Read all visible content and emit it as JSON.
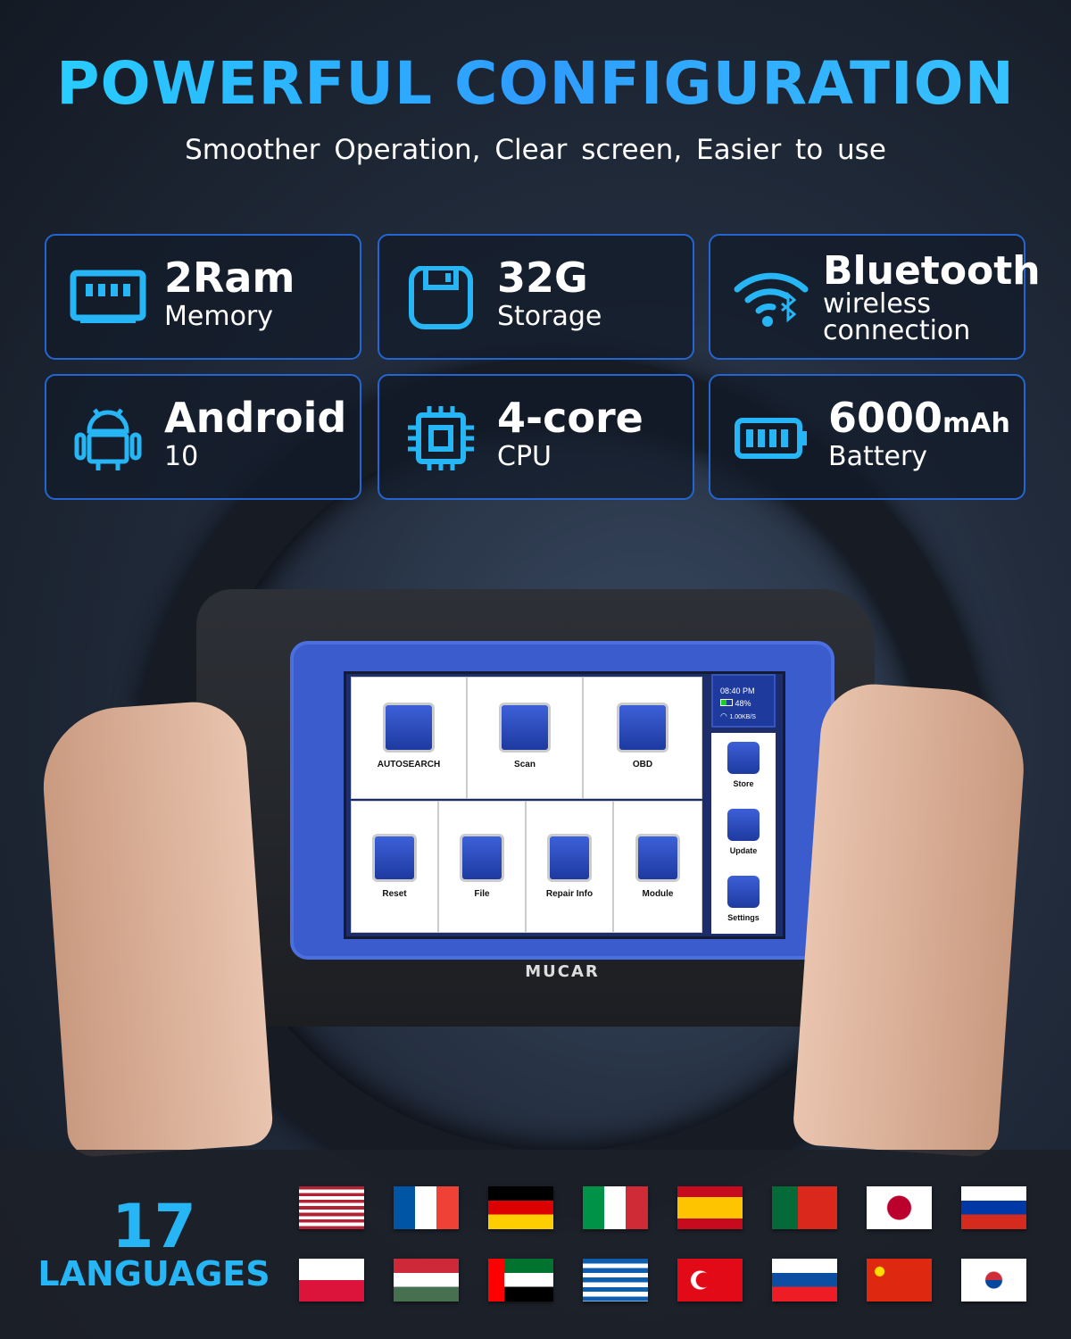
{
  "header": {
    "title": "POWERFUL CONFIGURATION",
    "subtitle": "Smoother Operation,  Clear screen,  Easier to use"
  },
  "accent": "#26b5f5",
  "cards": [
    {
      "icon": "ram-chip-icon",
      "big": "2Ram",
      "small": "Memory"
    },
    {
      "icon": "storage-icon",
      "big": "32G",
      "small": "Storage"
    },
    {
      "icon": "wifi-bluetooth-icon",
      "big": "Bluetooth",
      "small": "wireless connection"
    },
    {
      "icon": "android-icon",
      "big": "Android",
      "small": "10"
    },
    {
      "icon": "cpu-icon",
      "big": "4-core",
      "small": "CPU"
    },
    {
      "icon": "battery-icon",
      "big": "6000",
      "unit": "mAh",
      "small": "Battery"
    }
  ],
  "device": {
    "brand": "MUCAR",
    "status": {
      "time": "08:40 PM",
      "battery": "48%",
      "speed": "1.00KB/S"
    },
    "apps": [
      "AUTOSEARCH",
      "Scan",
      "OBD",
      "Reset",
      "File",
      "Repair Info",
      "Module"
    ],
    "side_apps": [
      "Store",
      "Update",
      "Settings"
    ]
  },
  "languages": {
    "count": "17",
    "label": "LANGUAGES",
    "flags": [
      "us",
      "fr",
      "de",
      "it",
      "es",
      "pt",
      "jp",
      "ru",
      "pl",
      "hu",
      "ae",
      "gr",
      "tr",
      "sk",
      "cn",
      "kr"
    ]
  }
}
